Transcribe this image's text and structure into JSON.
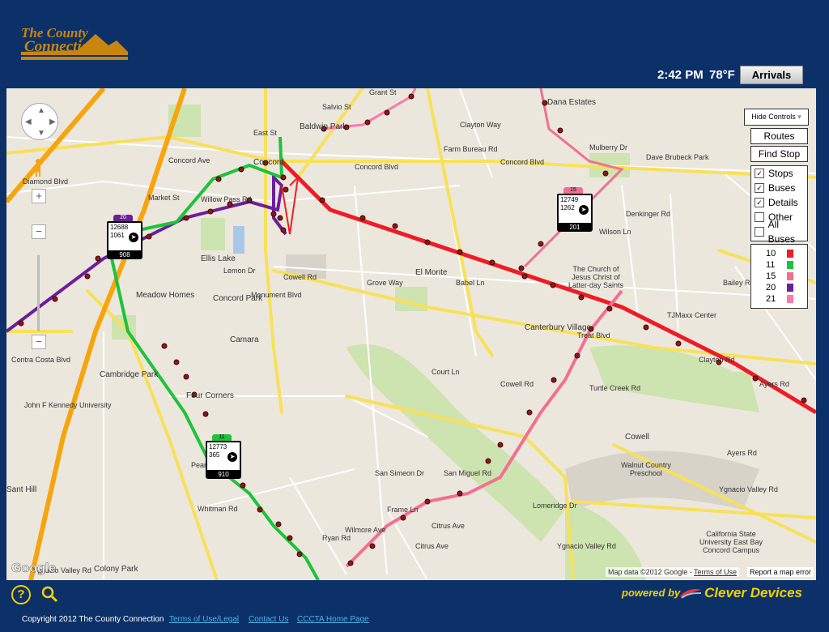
{
  "header": {
    "logo_line1": "The County",
    "logo_line2": "Connection",
    "time": "2:42 PM",
    "temperature": "78°F",
    "arrivals_label": "Arrivals"
  },
  "controls": {
    "hide_controls": "Hide Controls",
    "routes": "Routes",
    "find_stop": "Find Stop",
    "layers": [
      {
        "label": "Stops",
        "checked": true
      },
      {
        "label": "Buses",
        "checked": true
      },
      {
        "label": "Details",
        "checked": true
      },
      {
        "label": "Other",
        "checked": false
      },
      {
        "label": "All Buses",
        "checked": false
      }
    ],
    "legend": [
      {
        "route": "10",
        "color": "#ee1c25"
      },
      {
        "route": "11",
        "color": "#1ec23c"
      },
      {
        "route": "15",
        "color": "#f36f92"
      },
      {
        "route": "20",
        "color": "#6a1f9a"
      },
      {
        "route": "21",
        "color": "#ff7aa8"
      }
    ]
  },
  "map": {
    "labels": [
      "Salvio St",
      "Baldwin Park",
      "Willow Pass Rd",
      "Concord",
      "Concord Blvd",
      "Concord Ave",
      "Market St",
      "East St",
      "Grant St",
      "Farm Bureau Rd",
      "Clayton Way",
      "Dana Estates",
      "Mulberry Dr",
      "Dave Brubeck Park",
      "Concord Blvd",
      "Denkinger Rd",
      "Wilson Ln",
      "Babel Ln",
      "El Monte",
      "Grove Way",
      "Cowell Rd",
      "Monument Blvd",
      "Ellis Lake",
      "Meadow Homes",
      "Concord Park",
      "Camara",
      "Cambridge Park",
      "John F Kennedy University",
      "Four Corners",
      "Canterbury Village",
      "The Church of Jesus Christ of Latter-day Saints",
      "TJMaxx Center",
      "Bailey Rd",
      "Clayton Rd",
      "Treat Blvd",
      "Cowell",
      "Walnut Country Preschool",
      "Turtle Creek Rd",
      "Ayers Rd",
      "Ygnacio Valley Rd",
      "California State University East Bay Concord Campus",
      "Colony Park",
      "Whitman Rd",
      "Ygnacio Valley Rd",
      "Court Ln",
      "San Simeon Dr",
      "Frame Ln",
      "Citrus Ave",
      "Ryan Rd",
      "Wilmore Ave",
      "Pear Dr",
      "Diamond Blvd",
      "Contra Costa Blvd",
      "Lemon Dr",
      "San Miguel Rd",
      "Ayers Rd",
      "Cowell Rd",
      "Lomeridge Dr",
      "Ygnacio Valley Rd",
      "Citrus Ave",
      "Sant Hill"
    ],
    "attribution": "Map data ©2012 Google -",
    "terms_link": "Terms of Use",
    "report": "Report a map error",
    "google_logo": "Google"
  },
  "buses": [
    {
      "route": "20",
      "color": "#6a1f9a",
      "id": "12688",
      "trip": "1061",
      "block": "908"
    },
    {
      "route": "15",
      "color": "#f36f92",
      "id": "12749",
      "trip": "1262",
      "block": "201"
    },
    {
      "route": "11",
      "color": "#1ec23c",
      "id": "12773",
      "trip": "365",
      "block": "910"
    }
  ],
  "footer": {
    "powered_by": "powered by",
    "brand": "Clever Devices",
    "copyright": "Copyright 2012 The County Connection",
    "links": [
      "Terms of Use/Legal",
      "Contact Us",
      "CCCTA Home Page"
    ]
  },
  "icons": [
    "help-icon",
    "zoom-magnifier-icon",
    "pan-control-icon",
    "pegman-icon",
    "bus-icon"
  ]
}
